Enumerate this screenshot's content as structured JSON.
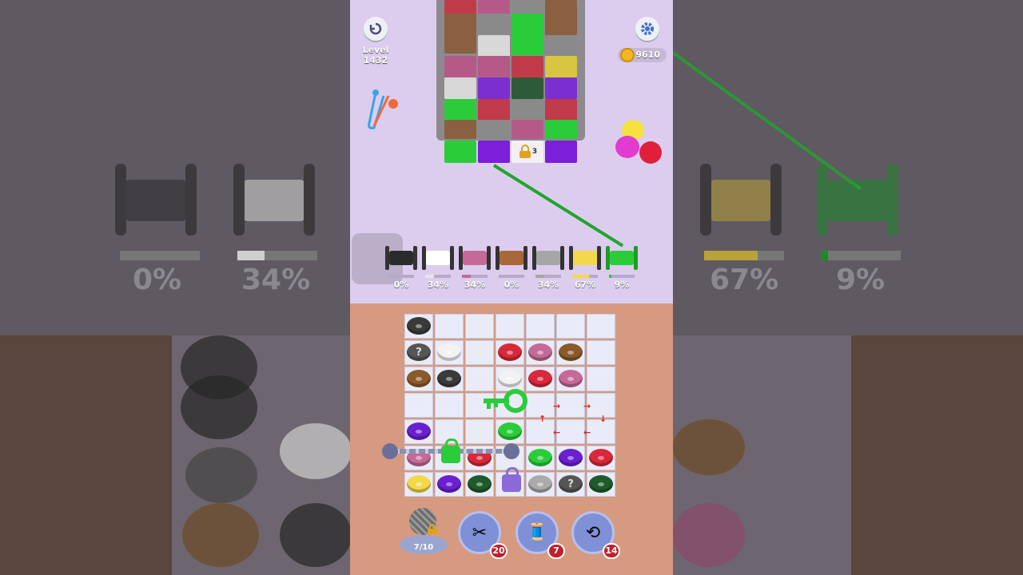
{
  "level": {
    "label": "Level 1432"
  },
  "coins": {
    "value": "9610"
  },
  "spools": [
    {
      "color": "#2b2b2b",
      "pct": "0%",
      "fill": 0
    },
    {
      "color": "#ffffff",
      "pct": "34%",
      "fill": 0.34
    },
    {
      "color": "#c56a98",
      "pct": "34%",
      "fill": 0.34
    },
    {
      "color": "#a8683a",
      "pct": "0%",
      "fill": 0
    },
    {
      "color": "#a6a6a6",
      "pct": "34%",
      "fill": 0.34
    },
    {
      "color": "#f4d84b",
      "pct": "67%",
      "fill": 0.67
    },
    {
      "color": "#2bcc3a",
      "pct": "9%",
      "fill": 0.09
    }
  ],
  "background_percentages": [
    "0%",
    "34%",
    "67%",
    "9%"
  ],
  "fabric_lock": {
    "count": "3"
  },
  "tray": {
    "label": "7/10"
  },
  "boosters": [
    {
      "name": "scissors",
      "icon": "✂",
      "count": "20"
    },
    {
      "name": "spool",
      "icon": "🧵",
      "count": "7"
    },
    {
      "name": "magnet",
      "icon": "⟲",
      "count": "14"
    }
  ],
  "colors": {
    "accent_green": "#2bcc3a",
    "badge_red": "#c0202b",
    "panel_purple": "#dccdef",
    "board_tan": "#d69a80"
  }
}
